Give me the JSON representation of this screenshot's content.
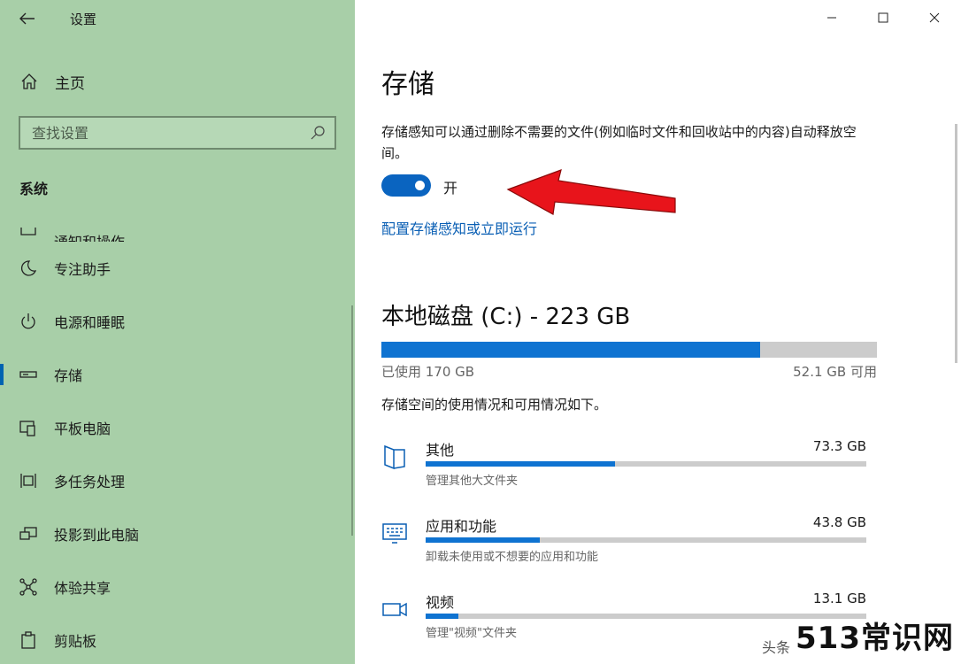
{
  "window": {
    "app_title": "设置",
    "back_icon": "arrow-left-icon"
  },
  "sidebar": {
    "home_label": "主页",
    "search_placeholder": "查找设置",
    "section_title": "系统",
    "items": [
      {
        "label": "通知和操作",
        "icon": "notification-icon"
      },
      {
        "label": "专注助手",
        "icon": "moon-icon"
      },
      {
        "label": "电源和睡眠",
        "icon": "power-icon"
      },
      {
        "label": "存储",
        "icon": "storage-icon",
        "active": true
      },
      {
        "label": "平板电脑",
        "icon": "tablet-icon"
      },
      {
        "label": "多任务处理",
        "icon": "multitasking-icon"
      },
      {
        "label": "投影到此电脑",
        "icon": "project-icon"
      },
      {
        "label": "体验共享",
        "icon": "share-icon"
      },
      {
        "label": "剪贴板",
        "icon": "clipboard-icon"
      }
    ]
  },
  "main": {
    "title": "存储",
    "description": "存储感知可以通过删除不需要的文件(例如临时文件和回收站中的内容)自动释放空间。",
    "toggle": {
      "state": "on",
      "label": "开"
    },
    "config_link": "配置存储感知或立即运行",
    "disk": {
      "title": "本地磁盘 (C:) - 223 GB",
      "used_fraction": 0.765,
      "used_label": "已使用 170 GB",
      "free_label": "52.1 GB 可用"
    },
    "overview_text": "存储空间的使用情况和可用情况如下。",
    "categories": [
      {
        "name": "其他",
        "size": "73.3 GB",
        "sub": "管理其他大文件夹",
        "fraction": 0.43,
        "icon": "folder-icon"
      },
      {
        "name": "应用和功能",
        "size": "43.8 GB",
        "sub": "卸载未使用或不想要的应用和功能",
        "fraction": 0.26,
        "icon": "apps-icon"
      },
      {
        "name": "视频",
        "size": "13.1 GB",
        "sub": "管理\"视频\"文件夹",
        "fraction": 0.075,
        "icon": "video-icon"
      }
    ]
  },
  "colors": {
    "sidebar_bg": "#a8cfa8",
    "accent": "#0a64c0",
    "bar_fill": "#0f73d1",
    "bar_track": "#cccccc",
    "arrow": "#e8141b"
  },
  "watermark": {
    "prefix": "头条",
    "brand": "513常识网"
  }
}
